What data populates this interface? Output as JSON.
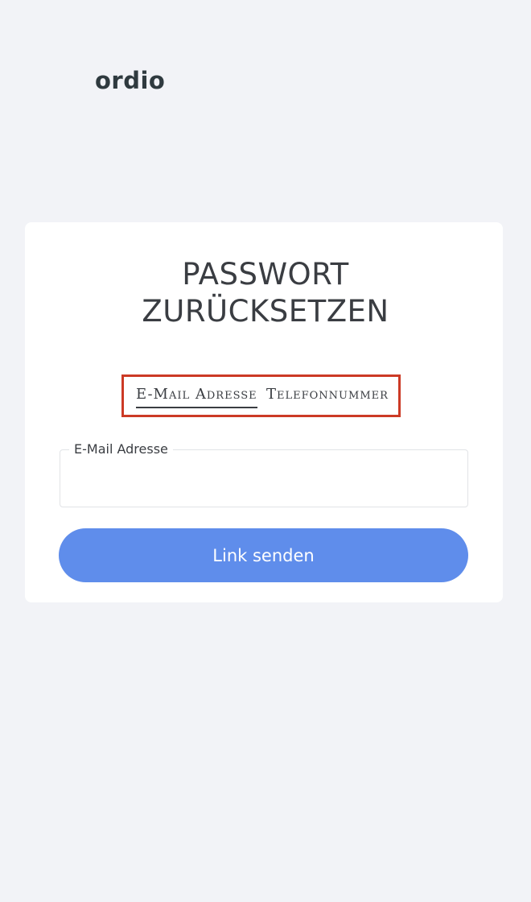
{
  "brand": {
    "logo_text": "ordio"
  },
  "reset": {
    "title_line1": "PASSWORT",
    "title_line2": "ZURÜCKSETZEN",
    "tabs": [
      {
        "label": "E-Mail Adresse",
        "active": true
      },
      {
        "label": "Telefonnummer",
        "active": false
      }
    ],
    "email_field": {
      "label": "E-Mail Adresse",
      "value": ""
    },
    "submit_label": "Link senden"
  },
  "colors": {
    "background": "#f2f3f7",
    "card": "#ffffff",
    "primary_button": "#5f8deb",
    "highlight_box": "#cc3a25",
    "text": "#3a3d42"
  }
}
